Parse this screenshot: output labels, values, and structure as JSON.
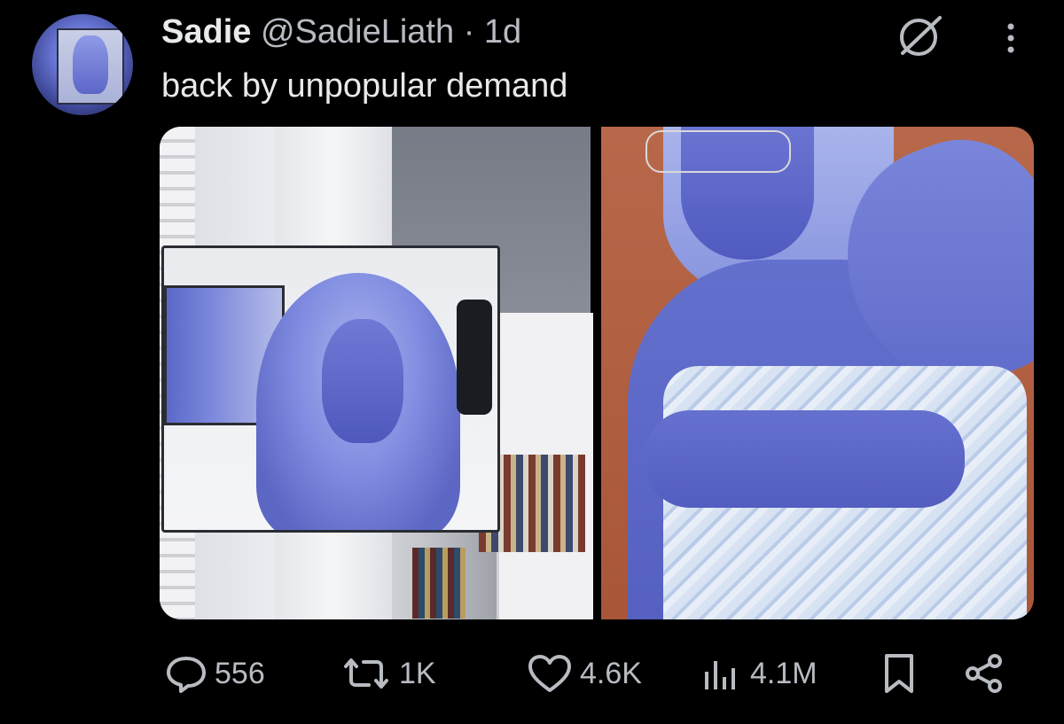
{
  "post": {
    "author_name": "Sadie",
    "author_handle": "@SadieLiath",
    "separator": "·",
    "time_ago": "1d",
    "text": "back by unpopular demand"
  },
  "icons": {
    "header_right": [
      "no-entry-icon",
      "more-options-icon"
    ],
    "actions": [
      "reply-icon",
      "repost-icon",
      "like-icon",
      "views-icon",
      "bookmark-icon",
      "share-icon"
    ]
  },
  "stats": {
    "replies": "556",
    "reposts": "1K",
    "likes": "4.6K",
    "views": "4.1M"
  },
  "colors": {
    "background": "#000000",
    "text_primary": "#e7e9ea",
    "text_secondary": "#b8bcc2"
  }
}
